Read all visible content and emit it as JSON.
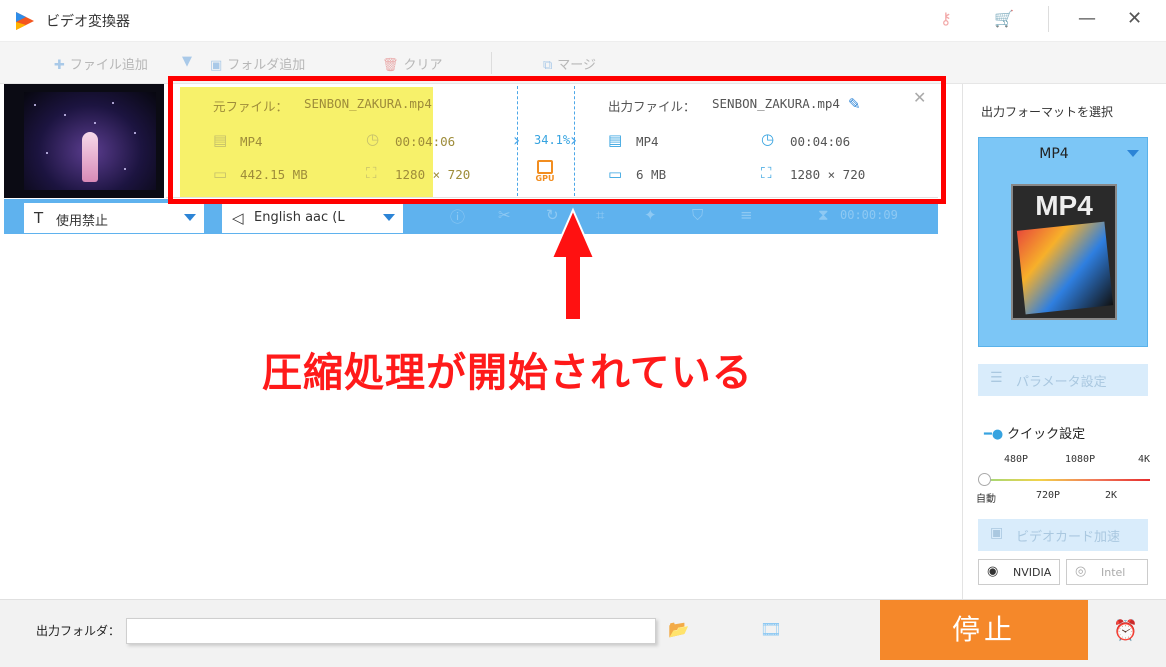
{
  "window": {
    "title": "ビデオ変換器"
  },
  "titlebar_icons": {
    "key": "key-icon",
    "cart": "cart-icon",
    "minimize": "—",
    "close": "✕"
  },
  "toolbar": {
    "add_file": "ファイル追加",
    "add_folder": "フォルダ追加",
    "clear": "クリア",
    "merge": "マージ"
  },
  "task": {
    "source_label": "元ファイル：",
    "source_name": "SENBON_ZAKURA.mp4",
    "source_format": "MP4",
    "source_duration": "00:04:06",
    "source_size": "442.15 MB",
    "source_resolution": "1280 × 720",
    "progress_text": "34.1%",
    "progress": 0.341,
    "gpu_label": "GPU",
    "output_label": "出力ファイル：",
    "output_name": "SENBON_ZAKURA.mp4",
    "output_format": "MP4",
    "output_duration": "00:04:06",
    "output_size": "6 MB",
    "output_resolution": "1280 × 720",
    "subtitle_select": "使用禁止",
    "audio_select": "English aac (L",
    "elapsed": "00:00:09"
  },
  "annotation": {
    "text": "圧縮処理が開始されている",
    "color": "#ff0000"
  },
  "right_panel": {
    "title": "出力フォーマットを選択",
    "format": "MP4",
    "format_image_text": "MP4",
    "param_button": "パラメータ設定",
    "quick_setting": "クイック設定",
    "slider_top_ticks": [
      "480P",
      "1080P",
      "4K"
    ],
    "slider_bottom_ticks": [
      "自動",
      "720P",
      "2K"
    ],
    "video_card_button": "ビデオカード加速",
    "brand_nvidia": "NVIDIA",
    "brand_intel": "Intel"
  },
  "bottom": {
    "output_folder_label": "出力フォルダ：",
    "output_folder_value": "",
    "stop_button": "停止"
  },
  "colors": {
    "accent": "#5fb2ee",
    "stop": "#f5882a",
    "highlight": "#f7f16a"
  }
}
